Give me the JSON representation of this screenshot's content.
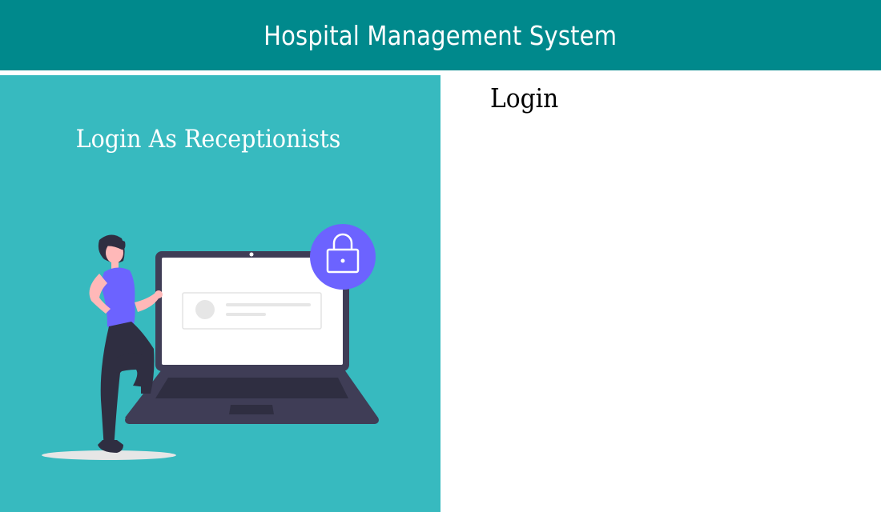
{
  "app": {
    "title": "Hospital Management System"
  },
  "left_panel": {
    "heading": "Login As Receptionists",
    "illustration": "woman-with-laptop-lock-illustration"
  },
  "right_panel": {
    "title": "Login"
  },
  "colors": {
    "header_bg": "#00898c",
    "panel_bg": "#37babf",
    "accent_purple": "#6c63ff",
    "laptop_dark": "#3f3d56"
  }
}
